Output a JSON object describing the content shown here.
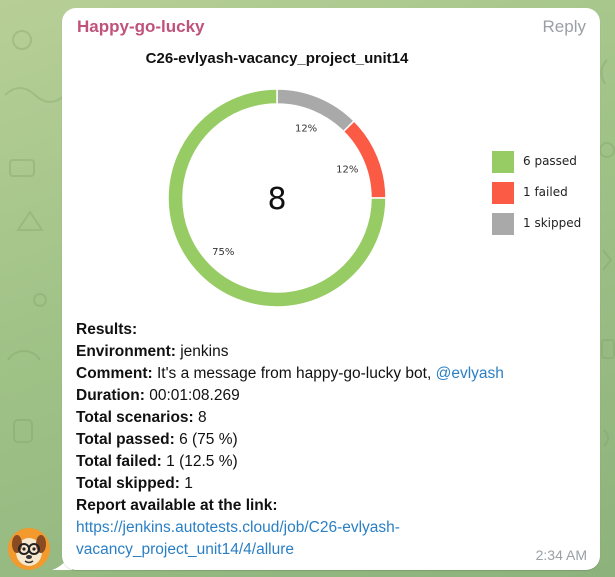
{
  "message": {
    "sender": "Happy-go-lucky",
    "reply_label": "Reply",
    "time": "2:34 AM",
    "avatar_icon": "dog-avatar-icon"
  },
  "chart_data": {
    "type": "pie",
    "title": "C26-evlyash-vacancy_project_unit14",
    "center_label": "8",
    "slices": [
      {
        "label": "skipped",
        "value": 1,
        "percent_label": "12%",
        "color": "#a9a9a9"
      },
      {
        "label": "failed",
        "value": 1,
        "percent_label": "12%",
        "color": "#fb5b45"
      },
      {
        "label": "passed",
        "value": 6,
        "percent_label": "75%",
        "color": "#97cc64"
      }
    ],
    "legend": [
      {
        "text": "6 passed",
        "color": "#97cc64"
      },
      {
        "text": "1 failed",
        "color": "#fb5b45"
      },
      {
        "text": "1 skipped",
        "color": "#a9a9a9"
      }
    ],
    "legend_position": "right"
  },
  "details": {
    "results_label": "Results:",
    "environment_label": "Environment:",
    "environment_value": "jenkins",
    "comment_label": "Comment:",
    "comment_value": "It's a message from happy-go-lucky bot,",
    "comment_mention": "@evlyash",
    "duration_label": "Duration:",
    "duration_value": "00:01:08.269",
    "scenarios_label": "Total scenarios:",
    "scenarios_value": "8",
    "passed_label": "Total passed:",
    "passed_value": "6 (75 %)",
    "failed_label": "Total failed:",
    "failed_value": "1 (12.5 %)",
    "skipped_label": "Total skipped:",
    "skipped_value": "1",
    "report_label": "Report available at the link:",
    "report_url_line1": "https://jenkins.autotests.cloud/job/C26-evlyash-",
    "report_url_line2": "vacancy_project_unit14/4/allure"
  }
}
